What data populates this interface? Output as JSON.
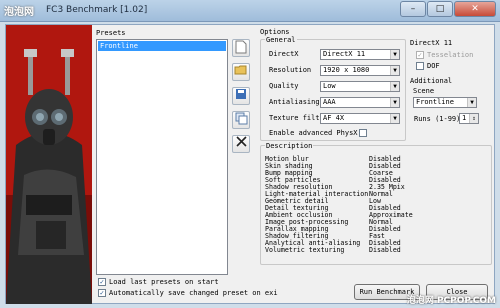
{
  "window": {
    "watermark": "泡泡网",
    "title": "FC3 Benchmark [1.02]",
    "minimize": "–",
    "maximize": "□",
    "close": "✕"
  },
  "presets": {
    "label": "Presets",
    "items": [
      "Frontline"
    ],
    "load_last": "Load last presets on start",
    "auto_save": "Automatically save changed preset on exi"
  },
  "side_buttons": {
    "new_icon": "new-document-icon",
    "open_icon": "open-folder-icon",
    "save_icon": "save-disk-icon",
    "copy_icon": "copy-icon",
    "delete_icon": "delete-x-icon"
  },
  "options": {
    "label": "Options",
    "general": {
      "label": "General",
      "directx_label": "DirectX",
      "directx_value": "DirectX 11",
      "resolution_label": "Resolution",
      "resolution_value": "1920 x 1080",
      "quality_label": "Quality",
      "quality_value": "Low",
      "aa_label": "Antialiasing",
      "aa_value": "AAA",
      "texture_label": "Texture filter",
      "texture_value": "AF 4X",
      "physx_label": "Enable advanced PhysX"
    },
    "dx11": {
      "label": "DirectX 11",
      "tessellation": "Tesselation",
      "dof": "DOF"
    },
    "additional": {
      "label": "Additional",
      "scene_label": "Scene",
      "scene_value": "Frontline",
      "runs_label": "Runs (1-99)",
      "runs_value": "1"
    }
  },
  "description": {
    "label": "Description",
    "rows": [
      {
        "k": "Motion blur",
        "v": "Disabled"
      },
      {
        "k": "Skin shading",
        "v": "Disabled"
      },
      {
        "k": "Bump mapping",
        "v": "Coarse"
      },
      {
        "k": "Soft particles",
        "v": "Disabled"
      },
      {
        "k": "Shadow resolution",
        "v": "2.35 Mpix"
      },
      {
        "k": "Light-material interaction",
        "v": "Normal"
      },
      {
        "k": "Geometric detail",
        "v": "Low"
      },
      {
        "k": "Detail texturing",
        "v": "Disabled"
      },
      {
        "k": "Ambient occlusion",
        "v": "Approximate"
      },
      {
        "k": "Image post-processing",
        "v": "Normal"
      },
      {
        "k": "Parallax mapping",
        "v": "Disabled"
      },
      {
        "k": "Shadow filtering",
        "v": "Fast"
      },
      {
        "k": "Analytical anti-aliasing",
        "v": "Disabled"
      },
      {
        "k": "Volumetric texturing",
        "v": "Disabled"
      }
    ]
  },
  "buttons": {
    "run": "Run Benchmark",
    "close": "Close"
  },
  "footer_watermark": "泡泡网 PCPOP.COM"
}
